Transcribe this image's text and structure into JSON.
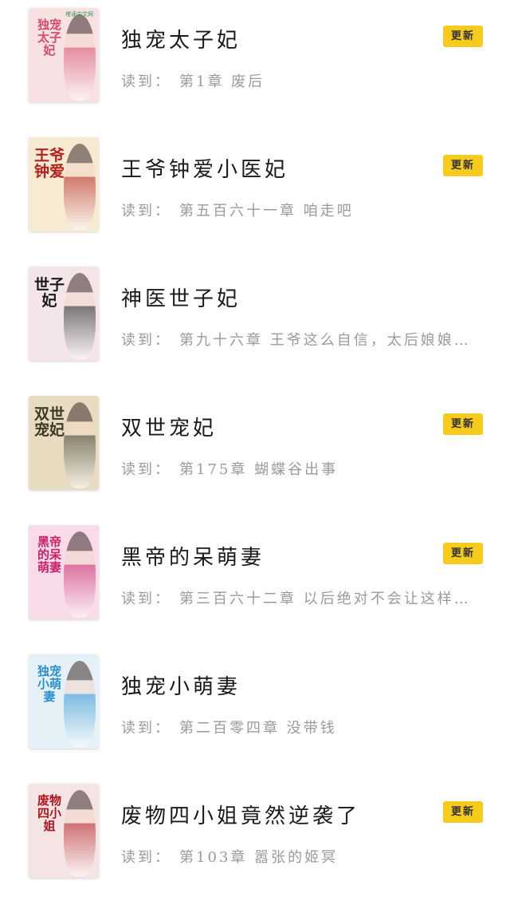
{
  "books": [
    {
      "title": "独宠太子妃",
      "read_label": "读到：",
      "progress": "第1章  废后",
      "badge": "更新",
      "show_badge": true,
      "cover": {
        "bg": "#f7e1e3",
        "accent": "#d64a6a",
        "title": "独宠太子妃",
        "publisher": "塔读中文网"
      }
    },
    {
      "title": "王爷钟爱小医妃",
      "read_label": "读到：",
      "progress": "第五百六十一章 咱走吧",
      "badge": "更新",
      "show_badge": true,
      "cover": {
        "bg": "#f6ead2",
        "accent": "#b5201d",
        "title": "王爷钟爱",
        "publisher": ""
      }
    },
    {
      "title": "神医世子妃",
      "read_label": "读到：",
      "progress": "第九十六章 王爷这么自信，太后娘娘知…",
      "badge": "",
      "show_badge": false,
      "cover": {
        "bg": "#f4e6e8",
        "accent": "#1a1a1a",
        "title": "世子妃",
        "publisher": ""
      }
    },
    {
      "title": "双世宠妃",
      "read_label": "读到：",
      "progress": "第175章 蝴蝶谷出事",
      "badge": "更新",
      "show_badge": true,
      "cover": {
        "bg": "#e8dcc0",
        "accent": "#3d3a2a",
        "title": "双世宠妃",
        "publisher": ""
      }
    },
    {
      "title": "黑帝的呆萌妻",
      "read_label": "读到：",
      "progress": "第三百六十二章 以后绝对不会让这样的…",
      "badge": "更新",
      "show_badge": true,
      "cover": {
        "bg": "#f8dbe9",
        "accent": "#c9206a",
        "title": "黑帝的呆萌妻",
        "publisher": ""
      }
    },
    {
      "title": "独宠小萌妻",
      "read_label": "读到：",
      "progress": "第二百零四章 没带钱",
      "badge": "",
      "show_badge": false,
      "cover": {
        "bg": "#e6f1f7",
        "accent": "#2a8fd0",
        "title": "独宠小萌妻",
        "publisher": ""
      }
    },
    {
      "title": "废物四小姐竟然逆袭了",
      "read_label": "读到：",
      "progress": "第103章 嚣张的姬冥",
      "badge": "更新",
      "show_badge": true,
      "cover": {
        "bg": "#f5e4e4",
        "accent": "#b0151d",
        "title": "废物四小姐",
        "publisher": ""
      }
    }
  ]
}
